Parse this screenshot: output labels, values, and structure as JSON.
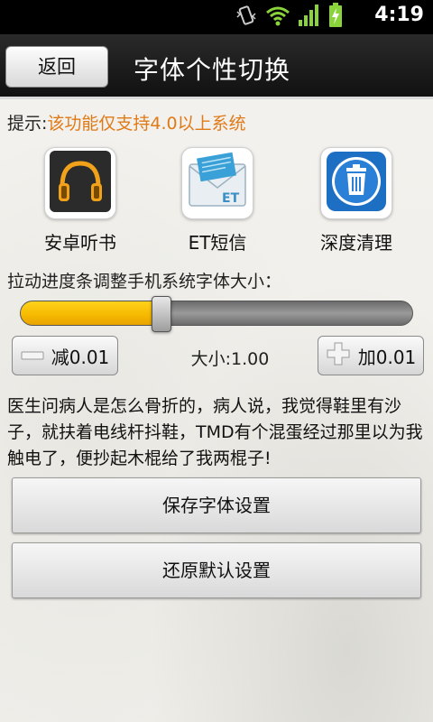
{
  "status_bar": {
    "time": "4:19",
    "icons": [
      "vibrate-icon",
      "wifi-icon",
      "signal-icon",
      "battery-charging-icon"
    ]
  },
  "header": {
    "back_label": "返回",
    "title": "字体个性切换"
  },
  "hint": {
    "label": "提示:",
    "text": "该功能仅支持4.0以上系统"
  },
  "apps": [
    {
      "label": "安卓听书",
      "icon": "headphones-icon"
    },
    {
      "label": "ET短信",
      "icon": "et-sms-icon"
    },
    {
      "label": "深度清理",
      "icon": "trash-icon"
    }
  ],
  "slider": {
    "caption": "拉动进度条调整手机系统字体大小：",
    "value_fraction": 0.36
  },
  "controls": {
    "decrease_label": "减0.01",
    "increase_label": "加0.01",
    "size_readout": "大小:1.00"
  },
  "joke_text": "医生问病人是怎么骨折的，病人说，我觉得鞋里有沙子，就扶着电线杆抖鞋，TMD有个混蛋经过那里以为我触电了，便抄起木棍给了我两棍子!",
  "actions": {
    "save_label": "保存字体设置",
    "restore_label": "还原默认设置"
  },
  "colors": {
    "hint_accent": "#e07a17",
    "slider_fill": "#f6b800"
  }
}
